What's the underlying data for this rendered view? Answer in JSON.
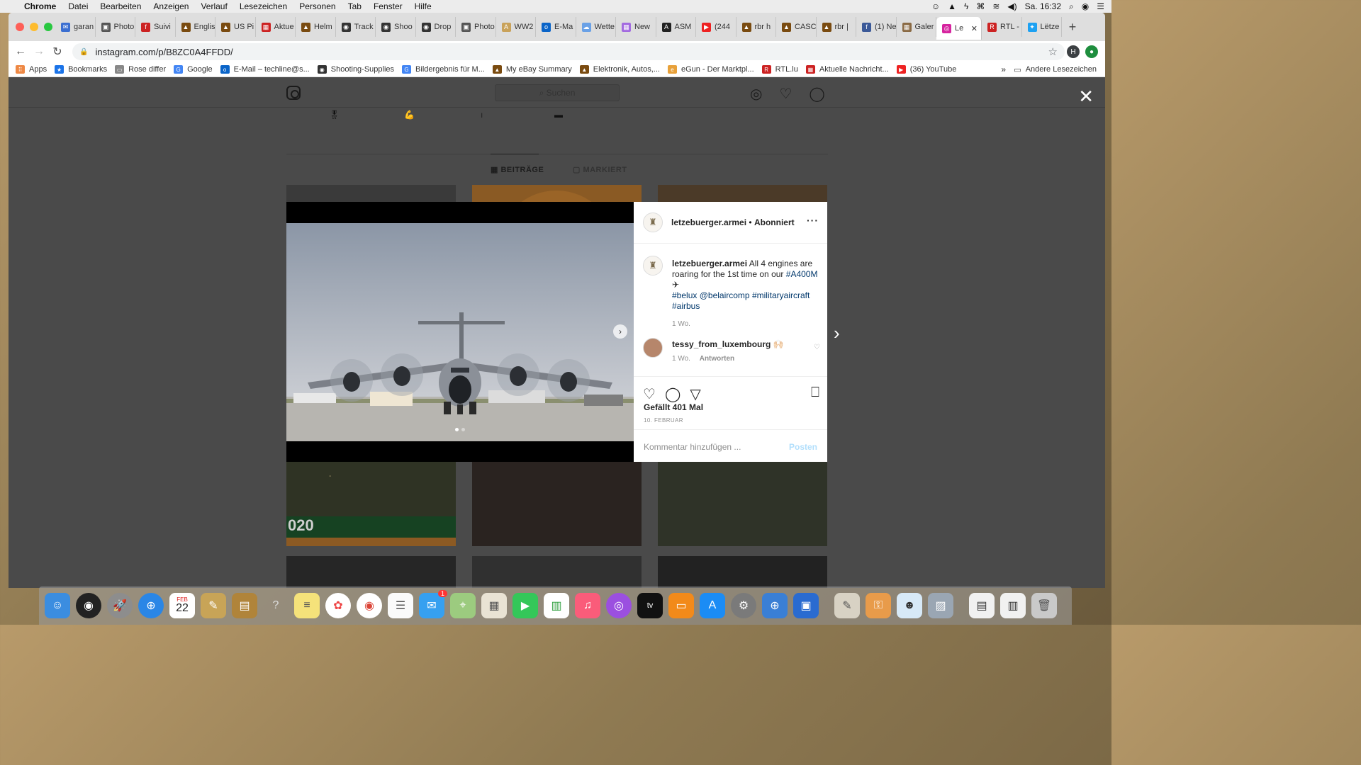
{
  "menubar": {
    "app": "Chrome",
    "items": [
      "Datei",
      "Bearbeiten",
      "Anzeigen",
      "Verlauf",
      "Lesezeichen",
      "Personen",
      "Tab",
      "Fenster",
      "Hilfe"
    ],
    "clock": "Sa. 16:32"
  },
  "tabs": [
    {
      "label": "garan",
      "color": "#3b6fd1",
      "glyph": "✉"
    },
    {
      "label": "Photo",
      "color": "#555",
      "glyph": "▣"
    },
    {
      "label": "Suivi",
      "color": "#c22",
      "glyph": "f"
    },
    {
      "label": "Englis",
      "color": "#7a4b10",
      "glyph": "▲"
    },
    {
      "label": "US Pi",
      "color": "#7a4b10",
      "glyph": "▲"
    },
    {
      "label": "Aktue",
      "color": "#c22",
      "glyph": "▦"
    },
    {
      "label": "Helm",
      "color": "#7a4b10",
      "glyph": "▲"
    },
    {
      "label": "Track",
      "color": "#333",
      "glyph": "◉"
    },
    {
      "label": "Shoo",
      "color": "#333",
      "glyph": "◉"
    },
    {
      "label": "Drop",
      "color": "#333",
      "glyph": "◉"
    },
    {
      "label": "Photo",
      "color": "#555",
      "glyph": "▣"
    },
    {
      "label": "WW2",
      "color": "#c9a25a",
      "glyph": "A"
    },
    {
      "label": "E-Ma",
      "color": "#0a64c8",
      "glyph": "o"
    },
    {
      "label": "Wette",
      "color": "#6aa1e6",
      "glyph": "☁"
    },
    {
      "label": "New",
      "color": "#a36be0",
      "glyph": "▦"
    },
    {
      "label": "ASM",
      "color": "#222",
      "glyph": "A"
    },
    {
      "label": "(244",
      "color": "#e22",
      "glyph": "▶"
    },
    {
      "label": "rbr h",
      "color": "#7a4b10",
      "glyph": "▲"
    },
    {
      "label": "CASC",
      "color": "#7a4b10",
      "glyph": "▲"
    },
    {
      "label": "rbr |",
      "color": "#7a4b10",
      "glyph": "▲"
    },
    {
      "label": "(1) Ne",
      "color": "#3b5998",
      "glyph": "f"
    },
    {
      "label": "Galer",
      "color": "#8a6a44",
      "glyph": "▦"
    },
    {
      "label": "Le",
      "color": "#d6249f",
      "glyph": "◎",
      "active": true
    },
    {
      "label": "RTL -",
      "color": "#c22",
      "glyph": "R"
    },
    {
      "label": "Lëtze",
      "color": "#1da1f2",
      "glyph": "✦"
    }
  ],
  "address": {
    "url": "instagram.com/p/B8ZC0A4FFDD/",
    "profile_initial": "H"
  },
  "bookmarks": [
    {
      "label": "Apps",
      "color": "#e84",
      "glyph": "⠿"
    },
    {
      "label": "Bookmarks",
      "color": "#1a73e8",
      "glyph": "★"
    },
    {
      "label": "Rose differ",
      "color": "#888",
      "glyph": "▭"
    },
    {
      "label": "Google",
      "color": "#4285f4",
      "glyph": "G"
    },
    {
      "label": "E-Mail – techline@s...",
      "color": "#0a64c8",
      "glyph": "o"
    },
    {
      "label": "Shooting-Supplies",
      "color": "#333",
      "glyph": "◉"
    },
    {
      "label": "Bildergebnis für M...",
      "color": "#4285f4",
      "glyph": "G"
    },
    {
      "label": "My eBay Summary",
      "color": "#7a4b10",
      "glyph": "▲"
    },
    {
      "label": "Elektronik, Autos,...",
      "color": "#7a4b10",
      "glyph": "▲"
    },
    {
      "label": "eGun - Der Marktpl...",
      "color": "#e8a13a",
      "glyph": "e"
    },
    {
      "label": "RTL.lu",
      "color": "#c22",
      "glyph": "R"
    },
    {
      "label": "Aktuelle Nachricht...",
      "color": "#c22",
      "glyph": "▦"
    },
    {
      "label": "(36) YouTube",
      "color": "#e22",
      "glyph": "▶"
    }
  ],
  "bookmarks_more": "»",
  "bookmarks_other": "Andere Lesezeichen",
  "instagram": {
    "search_placeholder": "Suchen",
    "profile_tabs": {
      "posts": "BEITRÄGE",
      "tagged": "MARKIERT"
    },
    "grid_text": {
      "year": "020"
    },
    "post": {
      "username": "letzebuerger.armei",
      "separator": "•",
      "follow_state": "Abonniert",
      "caption_user": "letzebuerger.armei",
      "caption_text": "All 4 engines are roaring for the 1st time on our",
      "caption_tag_1": "#A400M",
      "caption_emoji": "✈",
      "caption_tags": [
        "#belux",
        "@belaircomp",
        "#militaryaircraft",
        "#airbus"
      ],
      "caption_age": "1 Wo.",
      "comment_user": "tessy_from_luxembourg",
      "comment_text": "🙌🏻",
      "comment_age": "1 Wo.",
      "reply_label": "Antworten",
      "likes": "Gefällt 401 Mal",
      "date": "10. FEBRUAR",
      "add_comment_placeholder": "Kommentar hinzufügen ...",
      "post_button": "Posten",
      "carousel_index": 1,
      "carousel_count": 2
    }
  },
  "dock": {
    "calendar_month": "FEB",
    "calendar_day": "22",
    "messages_badge": "1"
  },
  "colors": {
    "instagram_link": "#00376b",
    "overlay": "#4a4a4a",
    "post_button": "#b2dffc"
  }
}
